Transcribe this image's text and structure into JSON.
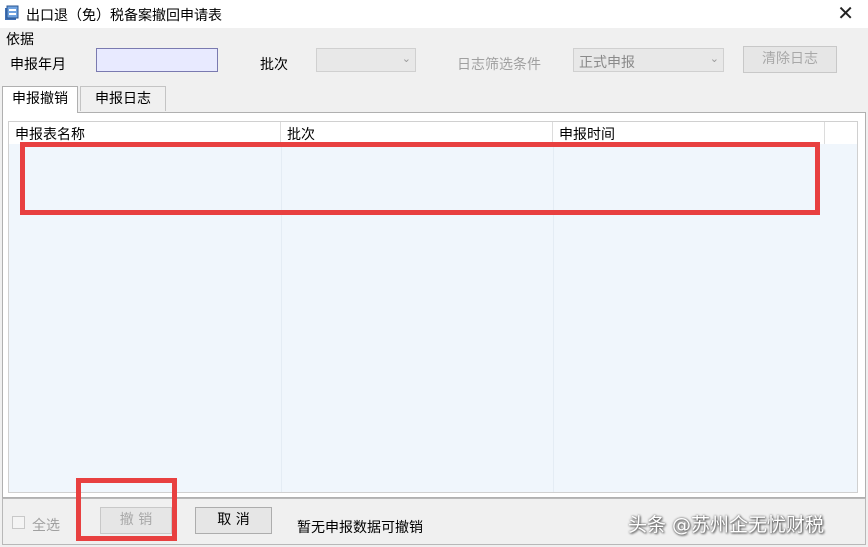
{
  "window": {
    "title": "出口退（免）税备案撤回申请表",
    "close_glyph": "✕"
  },
  "basis": {
    "group_label": "依据",
    "period_label": "申报年月",
    "period_value": "",
    "batch_label": "批次",
    "batch_value": "",
    "log_filter_label": "日志筛选条件",
    "log_filter_value": "正式申报",
    "clear_log_button": "清除日志"
  },
  "tabs": [
    {
      "label": "申报撤销",
      "active": true
    },
    {
      "label": "申报日志",
      "active": false
    }
  ],
  "table": {
    "columns": [
      "申报表名称",
      "批次",
      "申报时间"
    ],
    "rows": []
  },
  "footer": {
    "select_all_label": "全选",
    "select_all_checked": false,
    "revoke_button": "撤  销",
    "cancel_button": "取  消",
    "status_text": "暂无申报数据可撤销"
  },
  "watermark": "头条 @苏州企无忧财税",
  "icons": {
    "app": "app-window-icon",
    "dropdown": "chevron-down-icon"
  },
  "colors": {
    "highlight": "#e84040",
    "list_background": "#f0f6fc",
    "date_input_background": "#e8eaff"
  }
}
